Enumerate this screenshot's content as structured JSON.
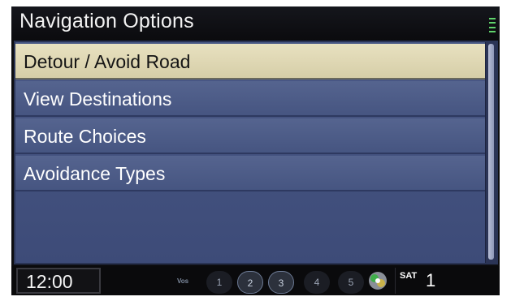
{
  "header": {
    "title": "Navigation Options",
    "signal_icon": "signal-strength-icon"
  },
  "menu": {
    "items": [
      {
        "label": "Detour / Avoid Road",
        "selected": true
      },
      {
        "label": "View Destinations",
        "selected": false
      },
      {
        "label": "Route Choices",
        "selected": false
      },
      {
        "label": "Avoidance Types",
        "selected": false
      }
    ]
  },
  "status_bar": {
    "clock": "12:00",
    "audio_label": "Vos",
    "presets": [
      "1",
      "2",
      "3",
      "4",
      "5"
    ],
    "source_label": "SAT",
    "source_channel": "1",
    "source_icon": "satellite-radio-icon"
  },
  "colors": {
    "selected_row": "#e2dbb8",
    "row": "#4f5e8a",
    "title_bar": "#111116",
    "signal": "#5fd36b"
  }
}
